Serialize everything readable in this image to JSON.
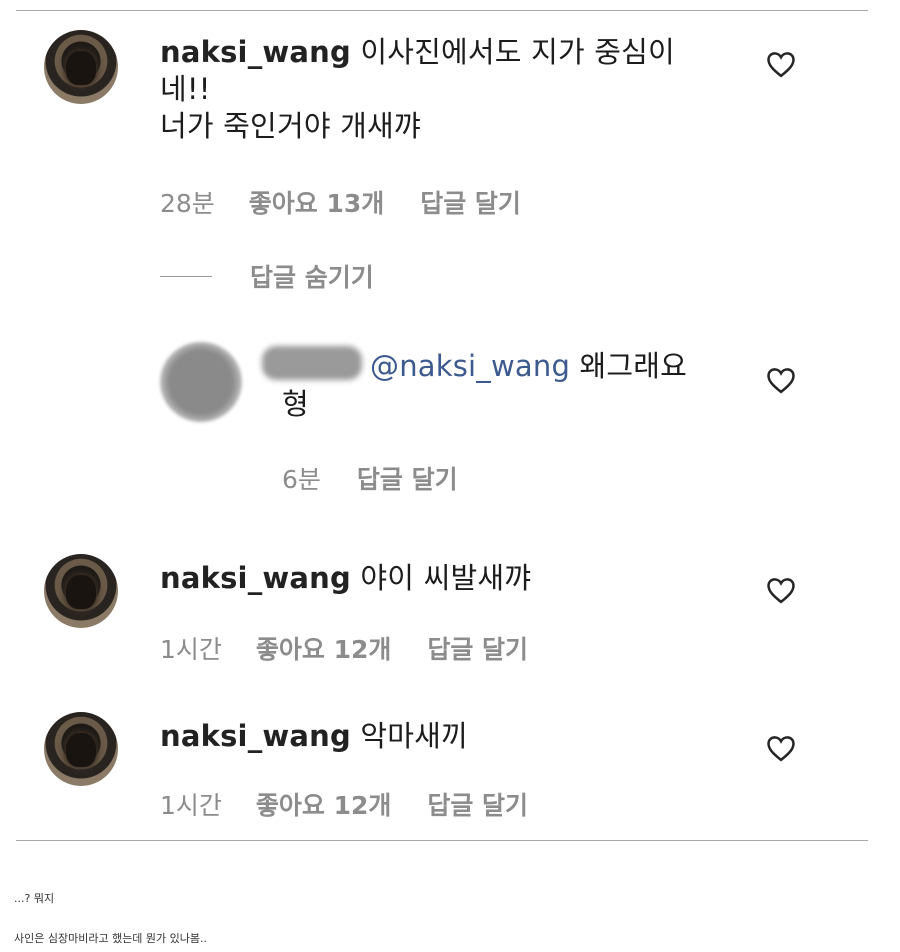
{
  "comments": [
    {
      "username": "naksi_wang",
      "text_line1": "이사진에서도 지가 중심이",
      "text_line2": "네!!",
      "text_line3": "너가 죽인거야 개새꺄",
      "time": "28분",
      "likes": "좋아요 13개",
      "reply": "답글 달기"
    },
    {
      "mention": "@naksi_wang",
      "text_line1": "왜그래요",
      "text_line2": "형",
      "time": "6분",
      "reply": "답글 달기"
    },
    {
      "username": "naksi_wang",
      "text_line1": "야이 씨발새꺄",
      "time": "1시간",
      "likes": "좋아요 12개",
      "reply": "답글 달기"
    },
    {
      "username": "naksi_wang",
      "text_line1": "악마새끼",
      "time": "1시간",
      "likes": "좋아요 12개",
      "reply": "답글 달기"
    }
  ],
  "hide_replies": "답글 숨기기",
  "captions": {
    "line1": "...? 뭐지",
    "line2": "사인은 심장마비라고 했는데 뭔가 있나봄.."
  },
  "icons": {
    "like": "heart-icon"
  }
}
